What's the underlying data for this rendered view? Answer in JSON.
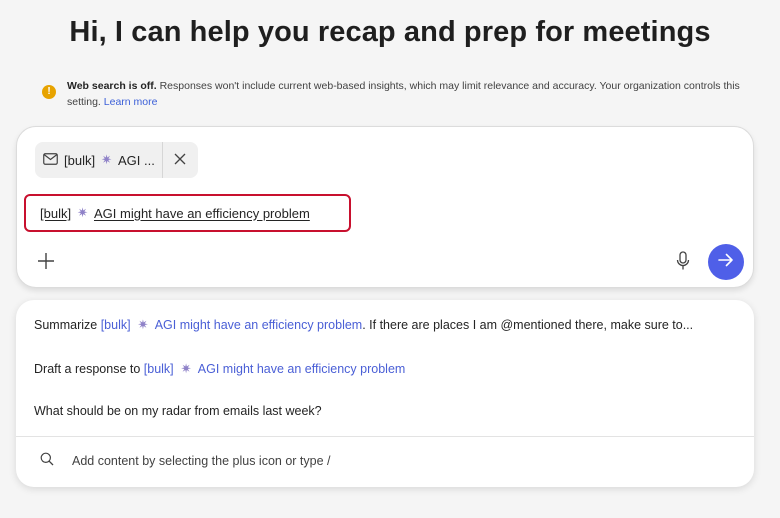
{
  "header": {
    "title": "Hi, I can help you recap and prep for meetings"
  },
  "notice": {
    "bold": "Web search is off.",
    "text": " Responses won't include current web-based insights, which may limit relevance and accuracy. Your organization controls this setting. ",
    "link": "Learn more",
    "icon": "warning-icon",
    "icon_color": "#e7a300"
  },
  "composer": {
    "chip": {
      "icon": "mail-icon",
      "tag": "[bulk]",
      "text": "AGI ..."
    },
    "draft": {
      "tag": "[bulk]",
      "text": "AGI might have an efficiency problem",
      "highlight_color": "#c8102e"
    },
    "send_color": "#4f5fe8"
  },
  "suggestions": [
    {
      "prefix": "Summarize ",
      "tag": "[bulk]",
      "ref": "AGI might have an efficiency problem",
      "suffix": ". If there are places I am @mentioned there, make sure to..."
    },
    {
      "prefix": "Draft a response to ",
      "tag": "[bulk]",
      "ref": "AGI might have an efficiency problem",
      "suffix": ""
    },
    {
      "text": "What should be on my radar from emails last week?"
    }
  ],
  "search": {
    "placeholder": "Add content by selecting the plus icon or type /"
  }
}
